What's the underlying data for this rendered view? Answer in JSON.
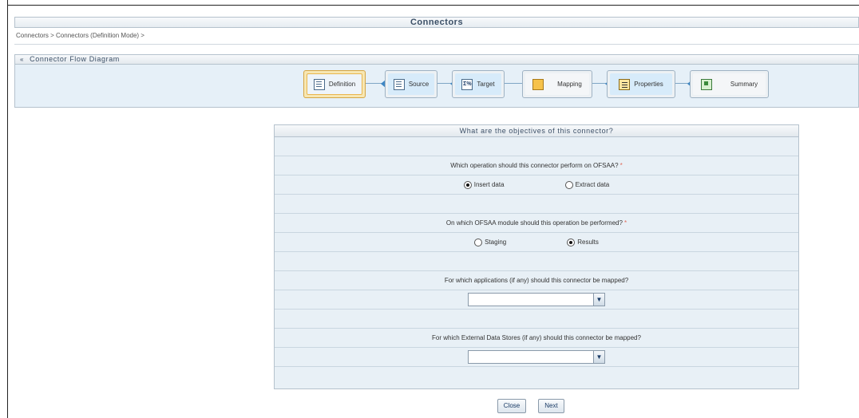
{
  "window": {
    "title": "Connectors"
  },
  "breadcrumb": "Connectors > Connectors (Definition Mode) >",
  "flow": {
    "header": "Connector Flow Diagram",
    "collapse_glyph": "«",
    "steps": [
      {
        "label": "Definition",
        "icon": "definition-icon",
        "glyph": ""
      },
      {
        "label": "Source",
        "icon": "source-icon",
        "glyph": ""
      },
      {
        "label": "Target",
        "icon": "target-icon",
        "glyph": "Σ%"
      },
      {
        "label": "Mapping",
        "icon": "mapping-icon",
        "glyph": ""
      },
      {
        "label": "Properties",
        "icon": "properties-icon",
        "glyph": ""
      },
      {
        "label": "Summary",
        "icon": "summary-icon",
        "glyph": ""
      }
    ],
    "active_step": "Definition"
  },
  "form": {
    "header": "What are the objectives of this connector?",
    "operation": {
      "question": "Which operation should this connector perform on OFSAA?",
      "required_mark": "*",
      "options": [
        {
          "label": "Insert data",
          "selected": true
        },
        {
          "label": "Extract data",
          "selected": false
        }
      ]
    },
    "module": {
      "question": "On which OFSAA module should this operation be performed?",
      "required_mark": "*",
      "options": [
        {
          "label": "Staging",
          "selected": false
        },
        {
          "label": "Results",
          "selected": true
        }
      ]
    },
    "applications": {
      "question": "For which applications (if any) should this connector be mapped?",
      "value": ""
    },
    "external_stores": {
      "question": "For which External Data Stores (if any) should this connector be mapped?",
      "value": ""
    }
  },
  "buttons": {
    "close": "Close",
    "next": "Next"
  },
  "colors": {
    "panel_bg": "#e8f0f6",
    "flow_bg": "#e6f0f8",
    "active_border": "#d5a545",
    "connector_arrow": "#3e86c4",
    "required": "#e06a5a"
  }
}
